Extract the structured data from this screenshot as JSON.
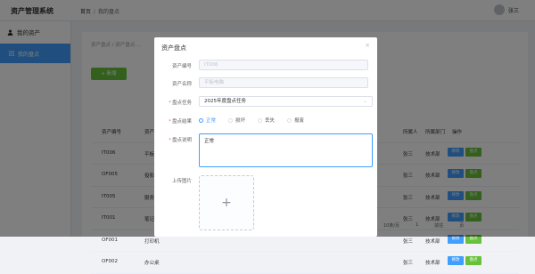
{
  "app": {
    "title": "资产管理系统"
  },
  "breadcrumb": {
    "home": "首页",
    "separator": "/",
    "current": "我的盘点"
  },
  "user": {
    "name": "张三"
  },
  "sidebar": {
    "section": "我的资产",
    "items": [
      {
        "label": "我的盘点"
      }
    ]
  },
  "page": {
    "breadcrumb": "资产盘点  /  资产盘点 ...",
    "add_label": "+ 新增",
    "table": {
      "headers": [
        "资产编号",
        "资产名",
        "所属人",
        "所属部门",
        "操作"
      ],
      "rows": [
        {
          "code": "IT006",
          "name": "平板...",
          "owner": "张三",
          "dept": "技术部"
        },
        {
          "code": "OF005",
          "name": "投影仪",
          "owner": "张三",
          "dept": "技术部"
        },
        {
          "code": "IT005",
          "name": "服务器",
          "owner": "张三",
          "dept": "技术部"
        },
        {
          "code": "IT001",
          "name": "笔记...",
          "owner": "张三",
          "dept": "技术部"
        },
        {
          "code": "OF001",
          "name": "打印机",
          "owner": "张三",
          "dept": "技术部"
        },
        {
          "code": "OF002",
          "name": "办公桌",
          "owner": "张三",
          "dept": "技术部"
        }
      ],
      "ops": {
        "edit": "修改",
        "check": "盘点"
      }
    },
    "pager": {
      "size": "10条/页",
      "page": "1",
      "jump": "前往",
      "unit": "页"
    }
  },
  "dialog": {
    "title": "资产盘点",
    "close_icon": "×",
    "fields": {
      "asset_code": {
        "label": "资产编号",
        "value": "IT006"
      },
      "asset_name": {
        "label": "资产名称",
        "value": "平板电脑"
      },
      "task": {
        "label": "盘点任务",
        "value": "2025年度盘点任务"
      },
      "result": {
        "label": "盘点结果",
        "options": [
          "正常",
          "损坏",
          "丢失",
          "报废"
        ],
        "selected": "正常"
      },
      "note": {
        "label": "盘点说明",
        "value": "正常"
      },
      "image": {
        "label": "上传图片",
        "plus": "+"
      }
    }
  },
  "colors": {
    "primary": "#409eff",
    "success": "#67c23a",
    "danger": "#f56c6c"
  }
}
